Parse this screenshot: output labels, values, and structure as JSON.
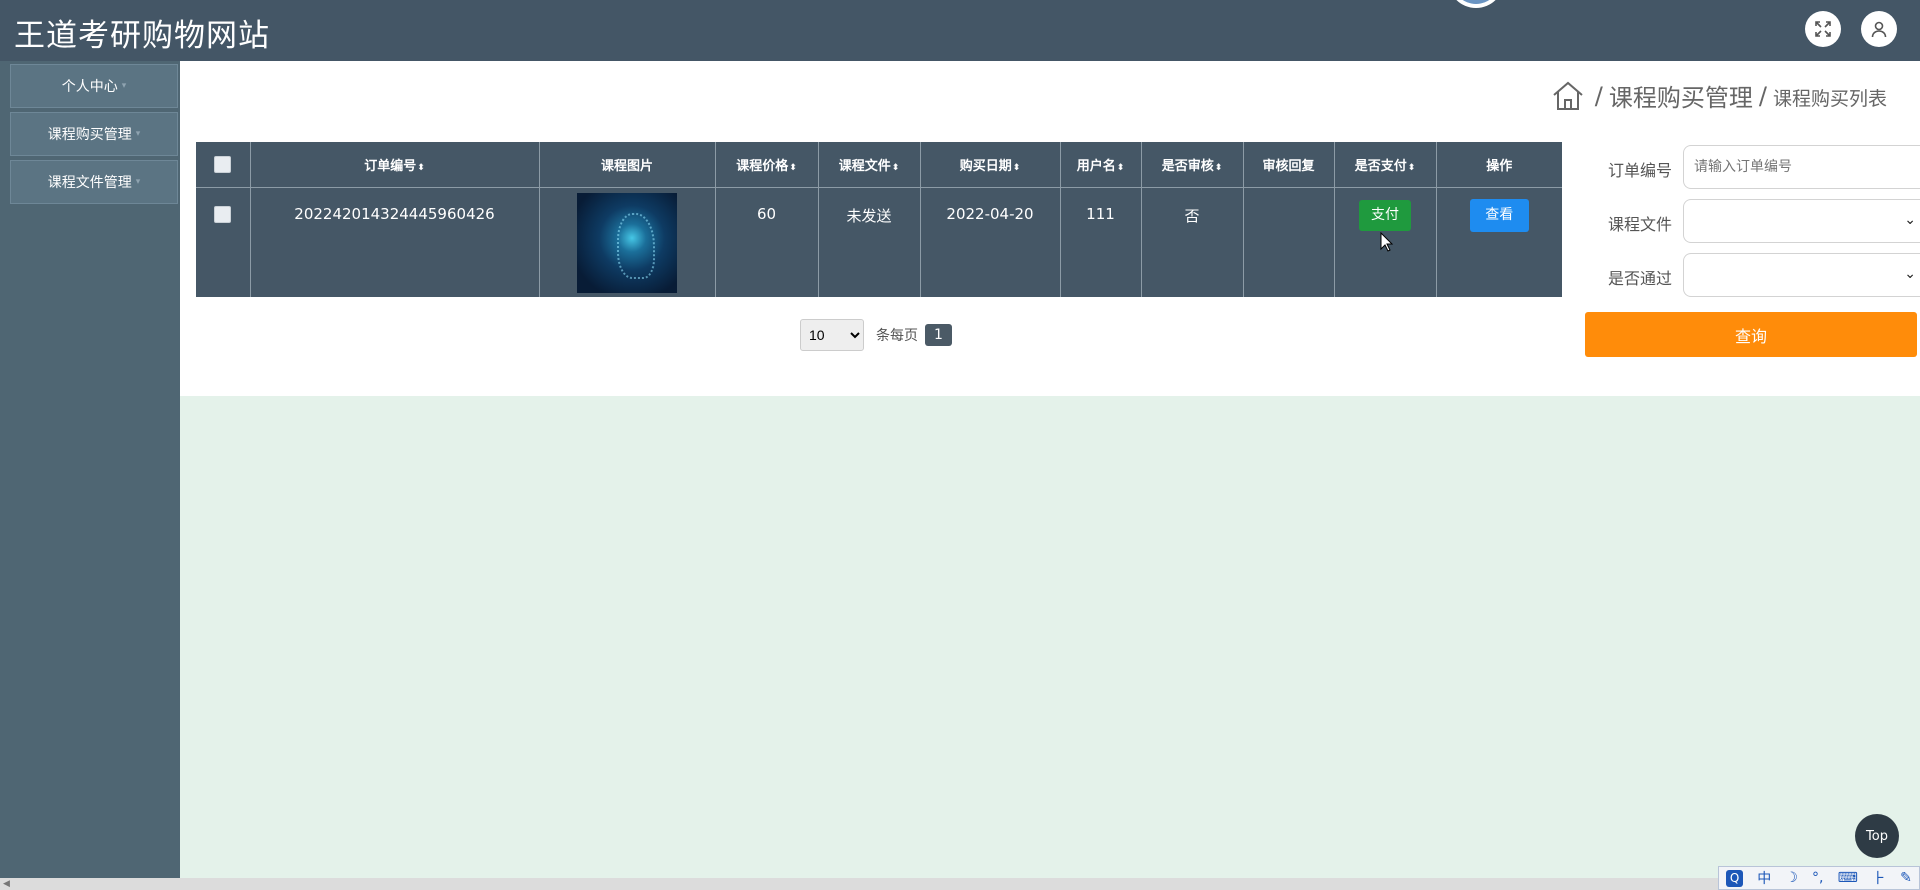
{
  "header": {
    "title": "王道考研购物网站",
    "fullscreen_icon": "expand-icon",
    "user_icon": "user-icon"
  },
  "sidebar": {
    "items": [
      {
        "label": "个人中心"
      },
      {
        "label": "课程购买管理"
      },
      {
        "label": "课程文件管理"
      }
    ]
  },
  "breadcrumb": {
    "home_icon": "home-icon",
    "separator": "/",
    "level1": "课程购买管理",
    "level2": "课程购买列表"
  },
  "table": {
    "columns": [
      "订单编号",
      "课程图片",
      "课程价格",
      "课程文件",
      "购买日期",
      "用户名",
      "是否审核",
      "审核回复",
      "是否支付",
      "操作"
    ],
    "sortable_marker": "⬍",
    "rows": [
      {
        "order_no": "20224201432444596042​6",
        "price": "60",
        "file": "未发送",
        "date": "2022-04-20",
        "username": "111",
        "reviewed": "否",
        "review_reply": "",
        "pay_label": "支付",
        "view_label": "查看"
      }
    ]
  },
  "pagination": {
    "page_size": "10",
    "page_size_options": [
      "10"
    ],
    "per_page_label": "条每页",
    "current_page": "1"
  },
  "filter": {
    "order_no_label": "订单编号",
    "order_no_placeholder": "请输入订单编号",
    "file_label": "课程文件",
    "passed_label": "是否通过",
    "query_label": "查询"
  },
  "widgets": {
    "top_label": "Top",
    "ime": [
      "中",
      "☽",
      "°,",
      "⌨",
      "⺊",
      "✎"
    ]
  },
  "colors": {
    "header_bg": "#445666",
    "sidebar_bg": "#4f6673",
    "table_bg": "#455766",
    "pay_button": "#1f9a3e",
    "view_button": "#1e8cf0",
    "query_button": "#ff8c0a"
  }
}
